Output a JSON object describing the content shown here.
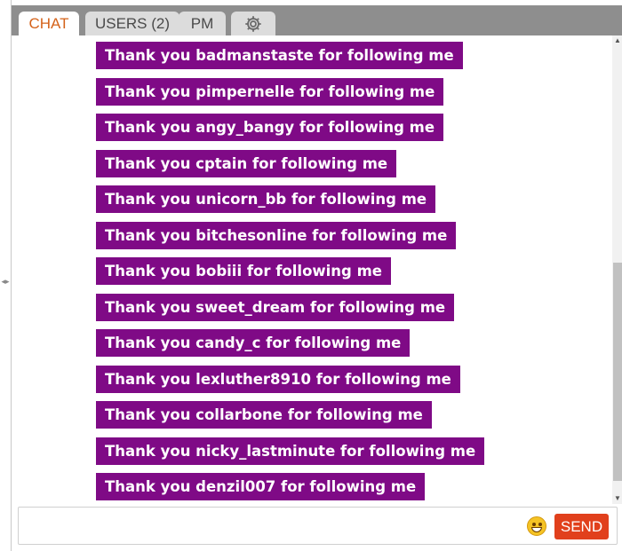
{
  "tabs": {
    "chat": "CHAT",
    "users": "USERS (2)",
    "pm": "PM",
    "settings_icon": "gear-icon"
  },
  "messages": [
    "Thank you badmanstaste for following me",
    "Thank you pimpernelle for following me",
    "Thank you angy_bangy for following me",
    "Thank you cptain for following me",
    "Thank you unicorn_bb for following me",
    "Thank you bitchesonline for following me",
    "Thank you bobiii for following me",
    "Thank you sweet_dream for following me",
    "Thank you candy_c for following me",
    "Thank you lexluther8910 for following me",
    "Thank you collarbone for following me",
    "Thank you nicky_lastminute for following me",
    "Thank you denzil007 for following me"
  ],
  "input": {
    "value": "",
    "placeholder": "",
    "emoji_icon": "grinning-emoji-icon",
    "send_label": "SEND"
  },
  "colors": {
    "message_bg": "#7f0a86",
    "active_tab_text": "#d4621a",
    "send_button": "#e1401c",
    "tabbar_bg": "#8e8e8e"
  }
}
